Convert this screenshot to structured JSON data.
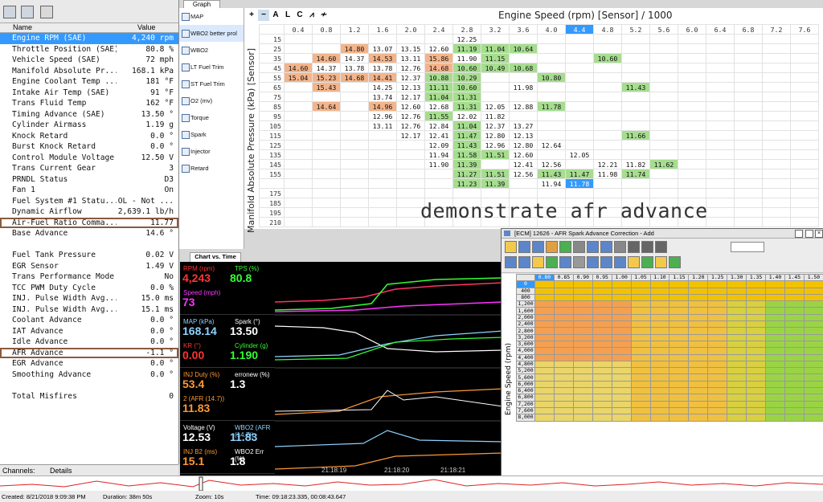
{
  "channels_panel": {
    "title": "Channels",
    "col_name": "Name",
    "col_value": "Value",
    "rows": [
      {
        "name": "Engine RPM (SAE)",
        "value": "4,240 rpm"
      },
      {
        "name": "Throttle Position (SAE)",
        "value": "80.8 %"
      },
      {
        "name": "Vehicle Speed (SAE)",
        "value": "72 mph"
      },
      {
        "name": "Manifold Absolute Pr...",
        "value": "168.1 kPa"
      },
      {
        "name": "Engine Coolant Temp ...",
        "value": "181 °F"
      },
      {
        "name": "Intake Air Temp (SAE)",
        "value": "91 °F"
      },
      {
        "name": "Trans Fluid Temp",
        "value": "162 °F"
      },
      {
        "name": "Timing Advance (SAE)",
        "value": "13.50 °"
      },
      {
        "name": "Cylinder Airmass",
        "value": "1.19 g"
      },
      {
        "name": "Knock Retard",
        "value": "0.0 °"
      },
      {
        "name": "Burst Knock Retard",
        "value": "0.0 °"
      },
      {
        "name": "Control Module Voltage",
        "value": "12.50 V"
      },
      {
        "name": "Trans Current Gear",
        "value": "3"
      },
      {
        "name": "PRNDL Status",
        "value": "D3"
      },
      {
        "name": "Fan 1",
        "value": "On"
      },
      {
        "name": "Fuel System #1 Statu...",
        "value": "OL - Not ..."
      },
      {
        "name": "Dynamic Airflow",
        "value": "2,639.1 lb/h"
      },
      {
        "name": "Air-Fuel Ratio Comma...",
        "value": "11.77"
      },
      {
        "name": "Base Advance",
        "value": "14.6 °"
      },
      {
        "name": "",
        "value": ""
      },
      {
        "name": "Fuel Tank Pressure",
        "value": "0.02 V"
      },
      {
        "name": "EGR Sensor",
        "value": "1.49 V"
      },
      {
        "name": "Trans Performance Mode",
        "value": "No"
      },
      {
        "name": "TCC PWM Duty Cycle",
        "value": "0.0 %"
      },
      {
        "name": "INJ. Pulse Width Avg...",
        "value": "15.0 ms"
      },
      {
        "name": "INJ. Pulse Width Avg...",
        "value": "15.1 ms"
      },
      {
        "name": "Coolant Advance",
        "value": "0.0 °"
      },
      {
        "name": "IAT Advance",
        "value": "0.0 °"
      },
      {
        "name": "Idle Advance",
        "value": "0.0 °"
      },
      {
        "name": "AFR Advance",
        "value": "-1.1 °"
      },
      {
        "name": "EGR Advance",
        "value": "0.0 °"
      },
      {
        "name": "Smoothing Advance",
        "value": "0.0 °"
      },
      {
        "name": "",
        "value": ""
      },
      {
        "name": "Total Misfires",
        "value": "0"
      }
    ],
    "tab_channels": "Channels:",
    "tab_details": "Details"
  },
  "graph": {
    "tab": "Graph",
    "items": [
      "MAP",
      "WBO2 better prol",
      "WBO2",
      "LT Fuel Trim",
      "ST Fuel Trim",
      "O2 (mv)",
      "Torque",
      "Spark",
      "Injector",
      "Retard"
    ],
    "toolbar": [
      "+",
      "−",
      "A",
      "L",
      "C",
      "⩘",
      "≁"
    ],
    "title": "Engine Speed (rpm) [Sensor] / 1000",
    "y_title": "Manifold Absolute Pressure (kPa) [Sensor]",
    "cols": [
      "0.4",
      "0.8",
      "1.2",
      "1.6",
      "2.0",
      "2.4",
      "2.8",
      "3.2",
      "3.6",
      "4.0",
      "4.4",
      "4.8",
      "5.2",
      "5.6",
      "6.0",
      "6.4",
      "6.8",
      "7.2",
      "7.6"
    ],
    "rows": [
      {
        "k": "15",
        "c": [
          "",
          "",
          "",
          "",
          "",
          "",
          "12.25",
          "",
          "",
          "",
          "",
          "",
          "",
          "",
          "",
          "",
          "",
          "",
          ""
        ]
      },
      {
        "k": "25",
        "c": [
          "",
          "",
          "14.80",
          "13.07",
          "13.15",
          "12.60",
          "11.19",
          "11.04",
          "10.64",
          "",
          "",
          "",
          "",
          "",
          "",
          "",
          "",
          "",
          ""
        ]
      },
      {
        "k": "35",
        "c": [
          "",
          "14.60",
          "14.37",
          "14.53",
          "13.11",
          "15.86",
          "11.90",
          "11.15",
          "",
          "",
          "",
          "10.60",
          "",
          "",
          "",
          "",
          "",
          "",
          ""
        ]
      },
      {
        "k": "45",
        "c": [
          "14.60",
          "14.37",
          "13.78",
          "13.78",
          "12.76",
          "14.68",
          "10.60",
          "10.49",
          "10.68",
          "",
          "",
          "",
          "",
          "",
          "",
          "",
          "",
          "",
          ""
        ]
      },
      {
        "k": "55",
        "c": [
          "15.04",
          "15.23",
          "14.68",
          "14.41",
          "12.37",
          "10.88",
          "10.29",
          "",
          "",
          "10.80",
          "",
          "",
          "",
          "",
          "",
          "",
          "",
          "",
          ""
        ]
      },
      {
        "k": "65",
        "c": [
          "",
          "15.43",
          "",
          "14.25",
          "12.13",
          "11.11",
          "10.60",
          "",
          "11.98",
          "",
          "",
          "",
          "11.43",
          "",
          "",
          "",
          "",
          "",
          ""
        ]
      },
      {
        "k": "75",
        "c": [
          "",
          "",
          "",
          "13.74",
          "12.17",
          "11.04",
          "11.31",
          "",
          "",
          "",
          "",
          "",
          "",
          "",
          "",
          "",
          "",
          "",
          ""
        ]
      },
      {
        "k": "85",
        "c": [
          "",
          "14.64",
          "",
          "14.96",
          "12.60",
          "12.68",
          "11.31",
          "12.05",
          "12.88",
          "11.78",
          "",
          "",
          "",
          "",
          "",
          "",
          "",
          "",
          ""
        ]
      },
      {
        "k": "95",
        "c": [
          "",
          "",
          "",
          "12.96",
          "12.76",
          "11.55",
          "12.02",
          "11.82",
          "",
          "",
          "",
          "",
          "",
          "",
          "",
          "",
          "",
          "",
          ""
        ]
      },
      {
        "k": "105",
        "c": [
          "",
          "",
          "",
          "13.11",
          "12.76",
          "12.84",
          "11.04",
          "12.37",
          "13.27",
          "",
          "",
          "",
          "",
          "",
          "",
          "",
          "",
          "",
          ""
        ]
      },
      {
        "k": "115",
        "c": [
          "",
          "",
          "",
          "",
          "12.17",
          "12.41",
          "11.47",
          "12.80",
          "12.13",
          "",
          "",
          "",
          "11.66",
          "",
          "",
          "",
          "",
          "",
          ""
        ]
      },
      {
        "k": "125",
        "c": [
          "",
          "",
          "",
          "",
          "",
          "12.09",
          "11.43",
          "12.96",
          "12.80",
          "12.64",
          "",
          "",
          "",
          "",
          "",
          "",
          "",
          "",
          ""
        ]
      },
      {
        "k": "135",
        "c": [
          "",
          "",
          "",
          "",
          "",
          "11.94",
          "11.58",
          "11.51",
          "12.60",
          "",
          "12.05",
          "",
          "",
          "",
          "",
          "",
          "",
          "",
          ""
        ]
      },
      {
        "k": "145",
        "c": [
          "",
          "",
          "",
          "",
          "",
          "11.90",
          "11.39",
          "",
          "12.41",
          "12.56",
          "",
          "12.21",
          "11.82",
          "11.62",
          "",
          "",
          "",
          "",
          ""
        ]
      },
      {
        "k": "155",
        "c": [
          "",
          "",
          "",
          "",
          "",
          "",
          "11.27",
          "11.51",
          "12.56",
          "11.43",
          "11.47",
          "11.98",
          "11.74",
          "",
          "",
          "",
          "",
          "",
          ""
        ]
      },
      {
        "k": "165",
        "c": [
          "",
          "",
          "",
          "",
          "",
          "",
          "11.23",
          "11.39",
          "",
          "11.94",
          "11.78",
          "",
          "",
          "",
          "",
          "",
          "",
          "",
          ""
        ]
      },
      {
        "k": "175",
        "c": [
          "",
          "",
          "",
          "",
          "",
          "",
          "",
          "",
          "",
          "",
          "",
          "",
          "",
          "",
          "",
          "",
          "",
          "",
          ""
        ]
      },
      {
        "k": "185",
        "c": [
          "",
          "",
          "",
          "",
          "",
          "",
          "",
          "",
          "",
          "",
          "",
          "",
          "",
          "",
          "",
          "",
          "",
          "",
          ""
        ]
      },
      {
        "k": "195",
        "c": [
          "",
          "",
          "",
          "",
          "",
          "",
          "",
          "",
          "",
          "",
          "",
          "",
          "",
          "",
          "",
          "",
          "",
          "",
          ""
        ]
      },
      {
        "k": "210",
        "c": [
          "",
          "",
          "",
          "",
          "",
          "",
          "",
          "",
          "",
          "",
          "",
          "",
          "",
          "",
          "",
          "",
          "",
          "",
          ""
        ]
      }
    ],
    "caption": "demonstrate afr advance"
  },
  "chart_vs_time": {
    "tab": "Chart vs. Time",
    "gauges": [
      {
        "l1": "RPM (rpm)",
        "v1": "4,243",
        "c1": "#ff3333",
        "l2": "TPS (%)",
        "v2": "80.8",
        "c2": "#33ff33",
        "l3": "Speed (mph)",
        "v3": "73",
        "c3": "#ff33ff"
      },
      {
        "l1": "MAP (kPa)",
        "v1": "168.14",
        "c1": "#8fd3ff",
        "l2": "Spark (°)",
        "v2": "13.50",
        "c2": "#ffffff",
        "l3": "KR (°)",
        "v3": "0.00",
        "c3": "#ff3333",
        "l4": "Cylinder (g)",
        "v4": "1.190",
        "c4": "#33ff33"
      },
      {
        "l1": "INJ Duty (%)",
        "v1": "53.4",
        "c1": "#ff9933",
        "l2": "erronew (%)",
        "v2": "1.3",
        "c2": "#ffffff",
        "l3": "2 (AFR (14.7))",
        "v3": "11.83",
        "c3": "#ff9933"
      },
      {
        "l1": "Voltage (V)",
        "v1": "12.53",
        "c1": "#ffffff",
        "l2": "WBO2 (AFR (14.7))",
        "v2": "11.83",
        "c2": "#8fd3ff",
        "l3": "INJ B2 (ms)",
        "v3": "15.1",
        "c3": "#ff9933",
        "l4": "WBO2 Err (%)",
        "v4": "1.8",
        "c4": "#ffffff"
      }
    ],
    "times": [
      "21:18:19",
      "21:18:20",
      "21:18:21"
    ]
  },
  "ecm_window": {
    "title": "[ECM] 12626 - AFR Spark Advance Correction - Add",
    "x_axis_title": "Engine Speed (rpm)",
    "cols": [
      "0.80",
      "0.85",
      "0.90",
      "0.95",
      "1.00",
      "1.05",
      "1.10",
      "1.15",
      "1.20",
      "1.25",
      "1.30",
      "1.35",
      "1.40",
      "1.45",
      "1.50"
    ],
    "rpms": [
      "0",
      "400",
      "800",
      "1,200",
      "1,600",
      "2,000",
      "2,400",
      "2,800",
      "3,200",
      "3,600",
      "4,000",
      "4,400",
      "4,800",
      "5,200",
      "5,600",
      "6,000",
      "6,400",
      "6,800",
      "7,200",
      "7,600",
      "8,000"
    ]
  },
  "status": {
    "created": "Created: 8/21/2018 9:09:38 PM",
    "duration": "Duration: 38m 50s",
    "zoom": "Zoom: 10s",
    "time": "Time: 09:18:23.335, 00:08:43.647"
  }
}
